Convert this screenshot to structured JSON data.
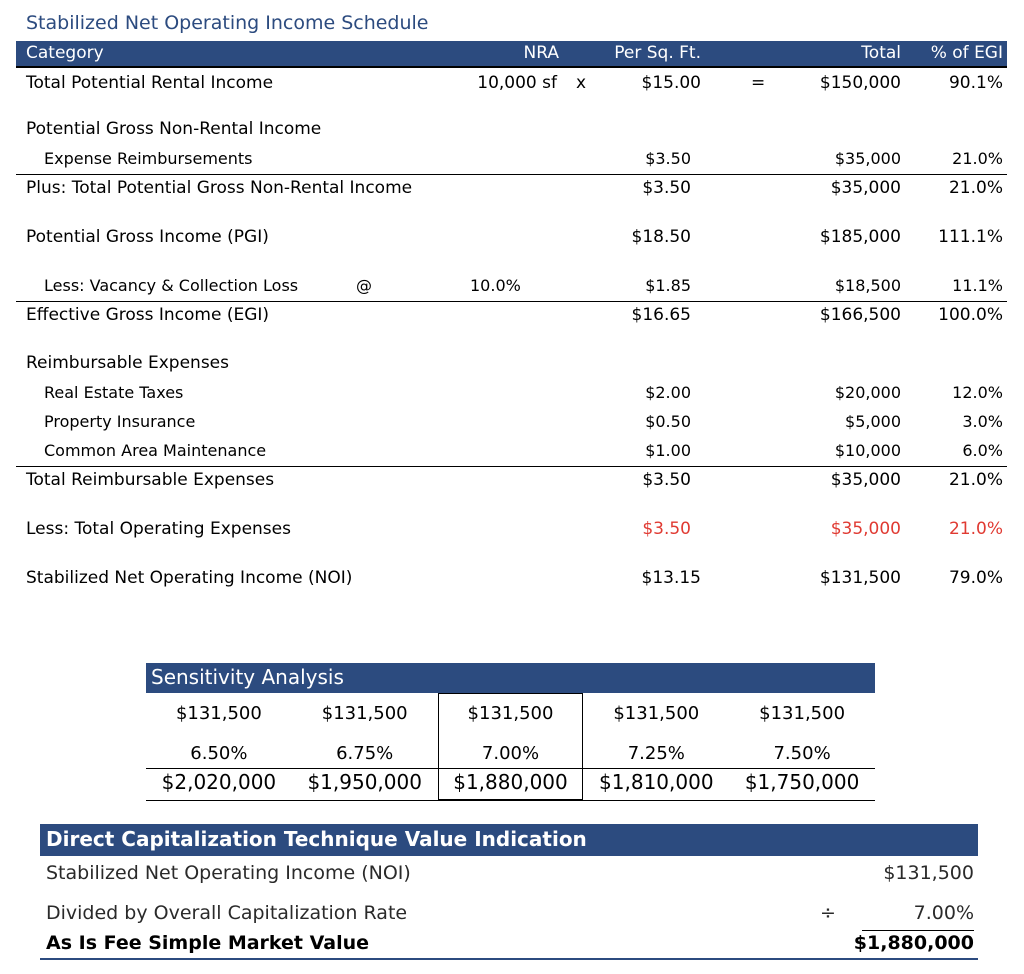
{
  "schedule": {
    "title": "Stabilized Net Operating Income Schedule",
    "headers": {
      "category": "Category",
      "nra": "NRA",
      "psf": "Per Sq. Ft.",
      "total": "Total",
      "egi": "% of EGI"
    },
    "tpri": {
      "label": "Total Potential Rental Income",
      "nra": "10,000 sf",
      "x": "x",
      "psf": "$15.00",
      "eq": "=",
      "total": "$150,000",
      "egi": "90.1%"
    },
    "pgnri_head": "Potential Gross Non-Rental Income",
    "exp_reimb": {
      "label": "Expense Reimbursements",
      "psf": "$3.50",
      "total": "$35,000",
      "egi": "21.0%"
    },
    "plus_total": {
      "label": "Plus: Total Potential Gross Non-Rental Income",
      "psf": "$3.50",
      "total": "$35,000",
      "egi": "21.0%"
    },
    "pgi": {
      "label": "Potential Gross Income (PGI)",
      "psf": "$18.50",
      "total": "$185,000",
      "egi": "111.1%"
    },
    "vacancy": {
      "label": "Less: Vacancy & Collection Loss",
      "at": "@",
      "rate": "10.0%",
      "psf": "$1.85",
      "total": "$18,500",
      "egi": "11.1%"
    },
    "egi_row": {
      "label": "Effective Gross Income (EGI)",
      "psf": "$16.65",
      "total": "$166,500",
      "egi": "100.0%"
    },
    "reimb_head": "Reimbursable Expenses",
    "taxes": {
      "label": "Real Estate Taxes",
      "psf": "$2.00",
      "total": "$20,000",
      "egi": "12.0%"
    },
    "insurance": {
      "label": "Property Insurance",
      "psf": "$0.50",
      "total": "$5,000",
      "egi": "3.0%"
    },
    "cam": {
      "label": "Common Area Maintenance",
      "psf": "$1.00",
      "total": "$10,000",
      "egi": "6.0%"
    },
    "total_reimb": {
      "label": "Total Reimbursable Expenses",
      "psf": "$3.50",
      "total": "$35,000",
      "egi": "21.0%"
    },
    "opex": {
      "label": "Less: Total Operating Expenses",
      "psf": "$3.50",
      "total": "$35,000",
      "egi": "21.0%"
    },
    "noi": {
      "label": "Stabilized Net Operating Income (NOI)",
      "psf": "$13.15",
      "total": "$131,500",
      "egi": "79.0%"
    }
  },
  "sensitivity": {
    "title": "Sensitivity Analysis",
    "columns": [
      {
        "noi": "$131,500",
        "rate": "6.50%",
        "value": "$2,020,000"
      },
      {
        "noi": "$131,500",
        "rate": "6.75%",
        "value": "$1,950,000"
      },
      {
        "noi": "$131,500",
        "rate": "7.00%",
        "value": "$1,880,000"
      },
      {
        "noi": "$131,500",
        "rate": "7.25%",
        "value": "$1,810,000"
      },
      {
        "noi": "$131,500",
        "rate": "7.50%",
        "value": "$1,750,000"
      }
    ]
  },
  "direct_cap": {
    "title": "Direct Capitalization Technique Value Indication",
    "noi_label": "Stabilized Net Operating Income (NOI)",
    "noi_value": "$131,500",
    "rate_label": "Divided by Overall Capitalization Rate",
    "divide": "÷",
    "rate_value": "7.00%",
    "value_label": "As Is Fee Simple Market Value",
    "value": "$1,880,000"
  },
  "colors": {
    "header_bg": "#2c4b7f",
    "negative": "#e03a32"
  }
}
